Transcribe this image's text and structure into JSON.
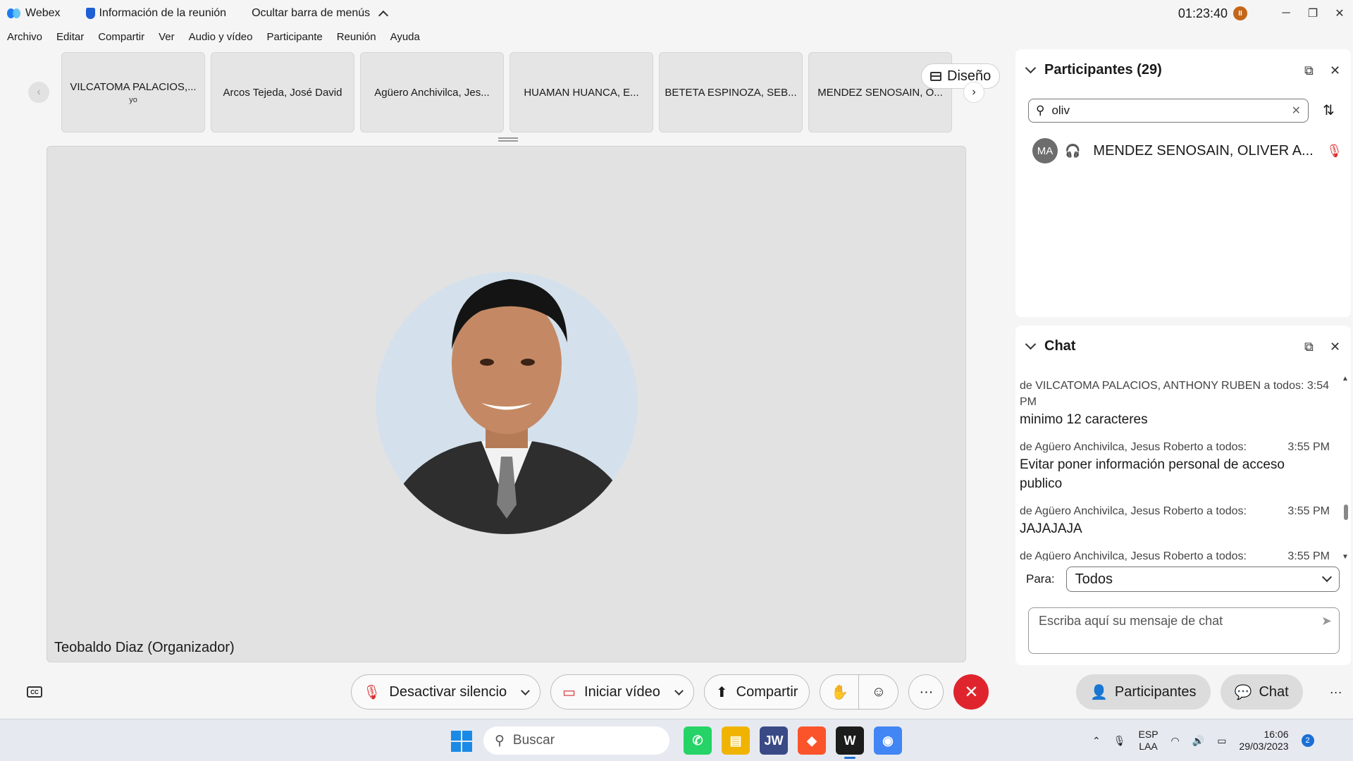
{
  "titlebar": {
    "app_name": "Webex",
    "meeting_info": "Información de la reunión",
    "hide_menu": "Ocultar barra de menús",
    "clock": "01:23:40",
    "pause_badge": "II"
  },
  "menu": [
    "Archivo",
    "Editar",
    "Compartir",
    "Ver",
    "Audio y vídeo",
    "Participante",
    "Reunión",
    "Ayuda"
  ],
  "thumbnails": [
    {
      "name": "VILCATOMA PALACIOS,...",
      "sub": "yo"
    },
    {
      "name": "Arcos Tejeda, José David",
      "sub": ""
    },
    {
      "name": "Agüero Anchivilca, Jes...",
      "sub": ""
    },
    {
      "name": "HUAMAN HUANCA, E...",
      "sub": ""
    },
    {
      "name": "BETETA ESPINOZA, SEB...",
      "sub": ""
    },
    {
      "name": "MENDEZ SENOSAIN, O...",
      "sub": ""
    }
  ],
  "layout_button": "Diseño",
  "stage": {
    "name": "Teobaldo Diaz (Organizador)"
  },
  "controls": {
    "unmute": "Desactivar silencio",
    "start_video": "Iniciar vídeo",
    "share": "Compartir",
    "cc": "CC",
    "more": "···",
    "end": "✕"
  },
  "right_controls": {
    "participants": "Participantes",
    "chat": "Chat",
    "more": "···"
  },
  "participants_panel": {
    "title": "Participantes (29)",
    "search_value": "oliv",
    "participant": {
      "initials": "MA",
      "name": "MENDEZ SENOSAIN, OLIVER A..."
    }
  },
  "chat_panel": {
    "title": "Chat",
    "messages": [
      {
        "meta": "de VILCATOMA PALACIOS, ANTHONY RUBEN a todos:",
        "time": "3:54 PM",
        "text": "minimo 12 caracteres"
      },
      {
        "meta": "de Agüero Anchivilca, Jesus Roberto a todos:",
        "time": "3:55 PM",
        "text": "Evitar poner información personal de acceso publico"
      },
      {
        "meta": "de Agüero Anchivilca, Jesus Roberto a todos:",
        "time": "3:55 PM",
        "text": "JAJAJAJA"
      },
      {
        "meta": "de Agüero Anchivilca, Jesus Roberto a todos:",
        "time": "3:55 PM",
        "text": ""
      }
    ],
    "to_label": "Para:",
    "to_value": "Todos",
    "input_placeholder": "Escriba aquí su mensaje de chat"
  },
  "taskbar": {
    "search_label": "Buscar",
    "apps": [
      {
        "name": "whatsapp-icon",
        "color": "#25d366",
        "glyph": "✆"
      },
      {
        "name": "file-explorer-icon",
        "color": "#f0b400",
        "glyph": "▤"
      },
      {
        "name": "jw-library-icon",
        "color": "#3a4a86",
        "glyph": "JW"
      },
      {
        "name": "brave-icon",
        "color": "#fb542b",
        "glyph": "◆"
      },
      {
        "name": "webex-icon",
        "color": "#1c1c1c",
        "glyph": "W"
      },
      {
        "name": "chrome-icon",
        "color": "#4285f4",
        "glyph": "◉"
      }
    ],
    "lang_top": "ESP",
    "lang_bottom": "LAA",
    "time": "16:06",
    "date": "29/03/2023",
    "notif_count": "2"
  }
}
